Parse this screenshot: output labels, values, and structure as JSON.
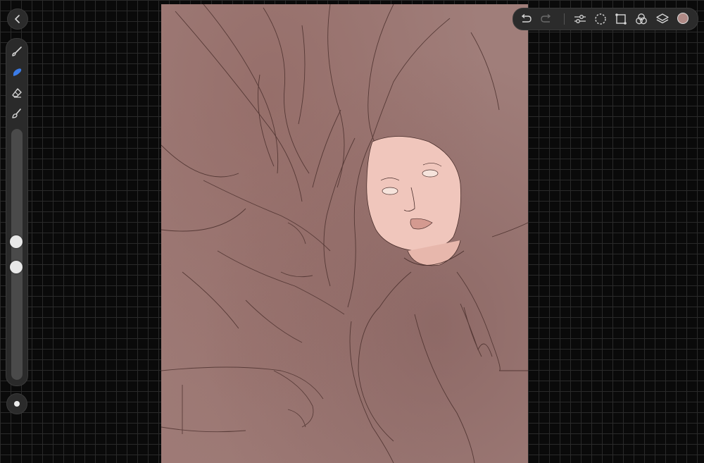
{
  "app": {
    "accent_color": "#3b7ce8",
    "icon_color": "#d6d6d6"
  },
  "navigation": {
    "back_icon": "chevron-left-icon"
  },
  "sidebar": {
    "tools": [
      {
        "name": "brush",
        "icon": "brush-icon",
        "active": false
      },
      {
        "name": "smudge",
        "icon": "smudge-icon",
        "active": true
      },
      {
        "name": "eraser",
        "icon": "eraser-icon",
        "active": false
      },
      {
        "name": "paint",
        "icon": "paint-brush-icon",
        "active": false
      }
    ],
    "brush_size_level": 0.55,
    "brush_opacity_level": 0.47
  },
  "toolbar": {
    "buttons": [
      {
        "name": "undo",
        "icon": "undo-icon",
        "enabled": true
      },
      {
        "name": "redo",
        "icon": "redo-icon",
        "enabled": false
      },
      {
        "name": "adjustments",
        "icon": "sliders-icon"
      },
      {
        "name": "selection",
        "icon": "lasso-icon"
      },
      {
        "name": "transform",
        "icon": "transform-icon"
      },
      {
        "name": "color-blend",
        "icon": "blend-circles-icon"
      },
      {
        "name": "layers",
        "icon": "layers-icon"
      }
    ],
    "current_color": "#b08a86"
  },
  "canvas": {
    "background_color": "#a07e7a",
    "line_color": "#4a2f2c",
    "skin_color": "#f0c6bc"
  }
}
